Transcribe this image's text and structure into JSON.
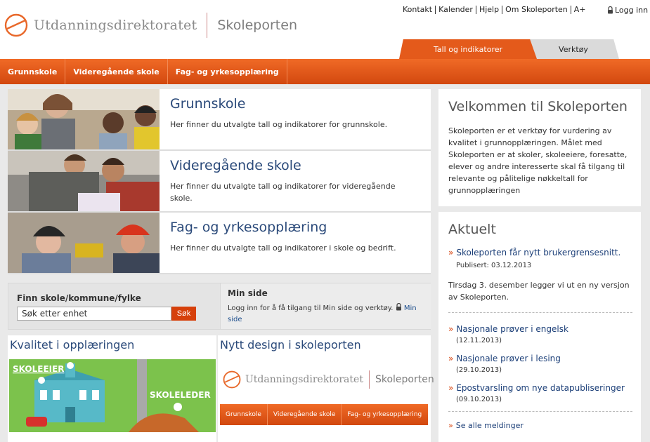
{
  "header": {
    "org_name": "Utdanningsdirektoratet",
    "site_name": "Skoleporten",
    "top_links": [
      "Kontakt",
      "Kalender",
      "Hjelp",
      "Om Skoleporten",
      "A+"
    ],
    "login": "Logg inn",
    "tabs": [
      {
        "label": "Tall og indikatorer",
        "active": true
      },
      {
        "label": "Verktøy",
        "active": false
      }
    ]
  },
  "nav": {
    "items": [
      "Grunnskole",
      "Videregående skole",
      "Fag- og yrkesopplæring"
    ]
  },
  "cards": [
    {
      "title": "Grunnskole",
      "desc": "Her finner du utvalgte tall og indikatorer for grunnskole."
    },
    {
      "title": "Videregående skole",
      "desc": "Her finner du utvalgte tall og indikatorer for videregående skole."
    },
    {
      "title": "Fag- og yrkesopplæring",
      "desc": "Her finner du utvalgte tall og indikatorer i skole og bedrift."
    }
  ],
  "search": {
    "label": "Finn skole/kommune/fylke",
    "placeholder": "Søk etter enhet",
    "value": "Søk etter enhet",
    "button": "Søk"
  },
  "min_side": {
    "title": "Min side",
    "text": "Logg inn for å få tilgang til Min side og verktøy.",
    "link": "Min side"
  },
  "promos": {
    "left_title": "Kvalitet i opplæringen",
    "left_labels": [
      "SKOLEEIER",
      "SKOLELEDER"
    ],
    "right_title": "Nytt design i skoleporten",
    "right_org": "Utdanningsdirektoratet",
    "right_site": "Skoleporten",
    "right_nav": [
      "Grunnskole",
      "Videregående skole",
      "Fag- og yrkesopplæring"
    ]
  },
  "welcome": {
    "title": "Velkommen til Skoleporten",
    "text": "Skoleporten er et verktøy for vurdering av kvalitet i grunnopplæringen. Målet med Skoleporten er at skoler, skoleeiere, foresatte, elever og andre interesserte skal få tilgang til relevante og pålitelige nøkkeltall for grunnopplæringen"
  },
  "news": {
    "title": "Aktuelt",
    "items": [
      {
        "title": "Skoleporten får nytt brukergrensesnitt.",
        "date": "Publisert: 03.12.2013"
      },
      {
        "title": "Nasjonale prøver i engelsk",
        "date": "(12.11.2013)"
      },
      {
        "title": "Nasjonale prøver i lesing",
        "date": "(29.10.2013)"
      },
      {
        "title": "Epostvarsling om nye datapubliseringer",
        "date": "(09.10.2013)"
      }
    ],
    "body": "Tirsdag 3. desember legger vi ut en ny versjon av Skoleporten.",
    "see_all": "Se alle meldinger"
  },
  "colors": {
    "accent": "#e45a1b",
    "link": "#1c4d8c",
    "heading": "#2b4a7a"
  }
}
